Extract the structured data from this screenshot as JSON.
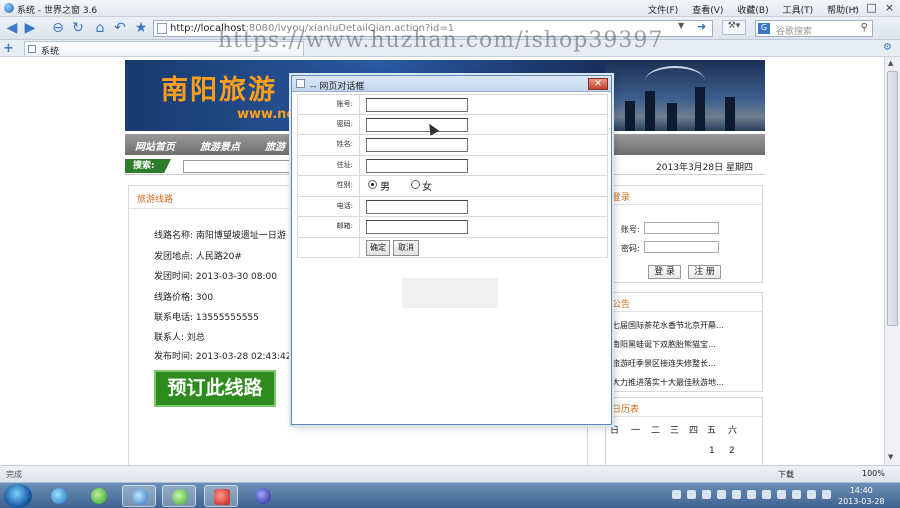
{
  "window": {
    "title": "系统 - 世界之窗 3.6",
    "menu": [
      "文件(F)",
      "查看(V)",
      "收藏(B)",
      "工具(T)",
      "帮助(H)"
    ],
    "controls": [
      "–",
      "□",
      "×"
    ]
  },
  "nav": {
    "url_host": "http://localhost",
    "url_path": ":8080/lvyou/xianluDetailQian.action?id=1",
    "search_placeholder": "谷歌搜索",
    "search_engine": "G",
    "tools_label": "⚒▾"
  },
  "tabs": {
    "active_label": "系统"
  },
  "watermark": "https://www.huzhan.com/ishop39397",
  "site": {
    "title": "南阳旅游",
    "url_fragment": "www.ne",
    "nav": [
      "网站首页",
      "旅游景点",
      "旅游"
    ],
    "search_label": "搜索:",
    "date": "2013年3月28日 星期四"
  },
  "route": {
    "panel_title": "旅游线路",
    "fields": [
      "线路名称: 南阳博望坡遗址一日游",
      "发团地点: 人民路20#",
      "发团时间: 2013-03-30 08:00",
      "线路价格: 300",
      "联系电话: 13555555555",
      "联系人: 刘总",
      "发布时间: 2013-03-28 02:43:42"
    ],
    "book_button": "预订此线路"
  },
  "login": {
    "panel_title": "登录",
    "account_label": "账号:",
    "password_label": "密码:",
    "login_button": "登 录",
    "register_button": "注 册"
  },
  "notice": {
    "panel_title": "公告",
    "items": [
      "七届国际茶花水香节北京开幕…",
      "南阳黑蛙诞下双胞胎熊猫宝…",
      "旅游旺季景区接连失修整长…",
      "大力推进落实十大最佳秋游地…"
    ]
  },
  "calendar": {
    "panel_title": "日历表",
    "weekdays": [
      "日",
      "一",
      "二",
      "三",
      "四",
      "五",
      "六"
    ],
    "days": [
      "1",
      "2"
    ]
  },
  "dialog": {
    "title": "-- 网页对话框",
    "fields": [
      {
        "label": "账号:",
        "value": ""
      },
      {
        "label": "密码:",
        "value": ""
      },
      {
        "label": "姓名:",
        "value": ""
      },
      {
        "label": "住址:",
        "value": ""
      }
    ],
    "gender_label": "性别:",
    "gender_options": [
      "男",
      "女"
    ],
    "gender_selected": "男",
    "phone_label": "电话:",
    "email_label": "邮箱:",
    "ok_button": "确定",
    "cancel_button": "取消"
  },
  "status": {
    "text": "完成",
    "download": "下载",
    "zoom": "100%"
  },
  "clock": {
    "time": "14:40",
    "date": "2013-03-28"
  }
}
